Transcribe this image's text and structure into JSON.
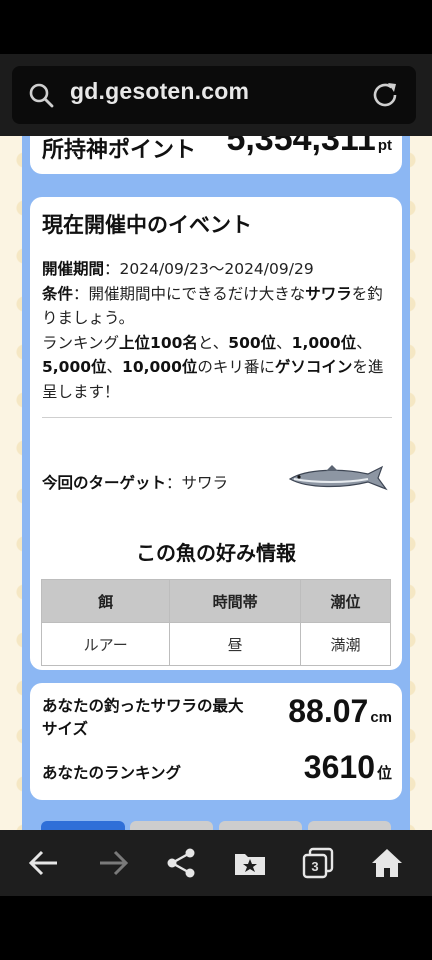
{
  "browser": {
    "url": "gd.gesoten.com",
    "tab_count": "3"
  },
  "points": {
    "label": "所持神ポイント",
    "value": "5,354,311",
    "unit": "pt"
  },
  "event": {
    "title": "現在開催中のイベント",
    "period_label": "開催期間",
    "period_value": "：2024/09/23〜2024/09/29",
    "condition_label": "条件",
    "condition_text_1": "：開催期間中にできるだけ大きな",
    "condition_fish": "サワラ",
    "condition_text_2": "を釣りましょう。",
    "ranking_text_1": "ランキング",
    "ranking_top": "上位100名",
    "ranking_text_2": "と、",
    "ranking_500": "500位",
    "ranking_sep1": "、",
    "ranking_1000": "1,000位",
    "ranking_sep2": "、",
    "ranking_5000": "5,000位",
    "ranking_sep3": "、",
    "ranking_10000": "10,000位",
    "ranking_text_3": "のキリ番に",
    "ranking_coin": "ゲソコイン",
    "ranking_text_4": "を進呈します！",
    "target_label": "今回のターゲット",
    "target_value": "：サワラ"
  },
  "preferences": {
    "title": "この魚の好み情報",
    "headers": [
      "餌",
      "時間帯",
      "潮位"
    ],
    "values": [
      "ルアー",
      "昼",
      "満潮"
    ]
  },
  "results": {
    "size_label": "あなたの釣ったサワラの最大サイズ",
    "size_value": "88.07",
    "size_unit": "cm",
    "rank_label": "あなたのランキング",
    "rank_value": "3610",
    "rank_unit": "位"
  },
  "colors": {
    "column_blue": "#8cb7f3",
    "active_tab": "#2f6fd8",
    "inactive_tab": "#cdcdcd"
  }
}
